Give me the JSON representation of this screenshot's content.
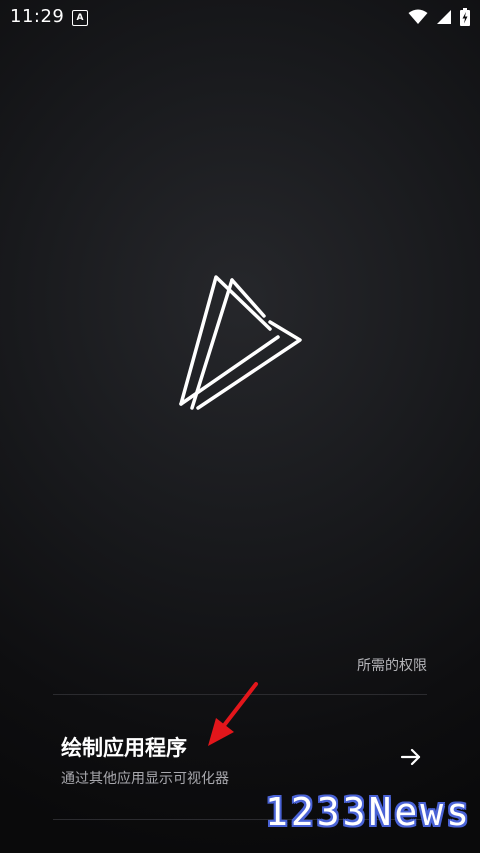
{
  "status_bar": {
    "time": "11:29",
    "notification_letter": "A",
    "icons": [
      "wifi-icon",
      "cellular-signal-icon",
      "battery-charging-icon"
    ]
  },
  "logo": {
    "icon": "double-triangle-play-logo"
  },
  "permissions": {
    "header": "所需的权限",
    "items": [
      {
        "title": "绘制应用程序",
        "description": "通过其他应用显示可视化器",
        "icon": "arrow-right-icon"
      }
    ]
  },
  "annotation": {
    "icon": "red-arrow-annotation",
    "color": "#e3161b"
  },
  "watermark": {
    "text": "1233News",
    "color": "#4a63d6"
  },
  "colors": {
    "background": "#111113",
    "text_primary": "#ffffff",
    "text_secondary": "#a8a8ad"
  }
}
